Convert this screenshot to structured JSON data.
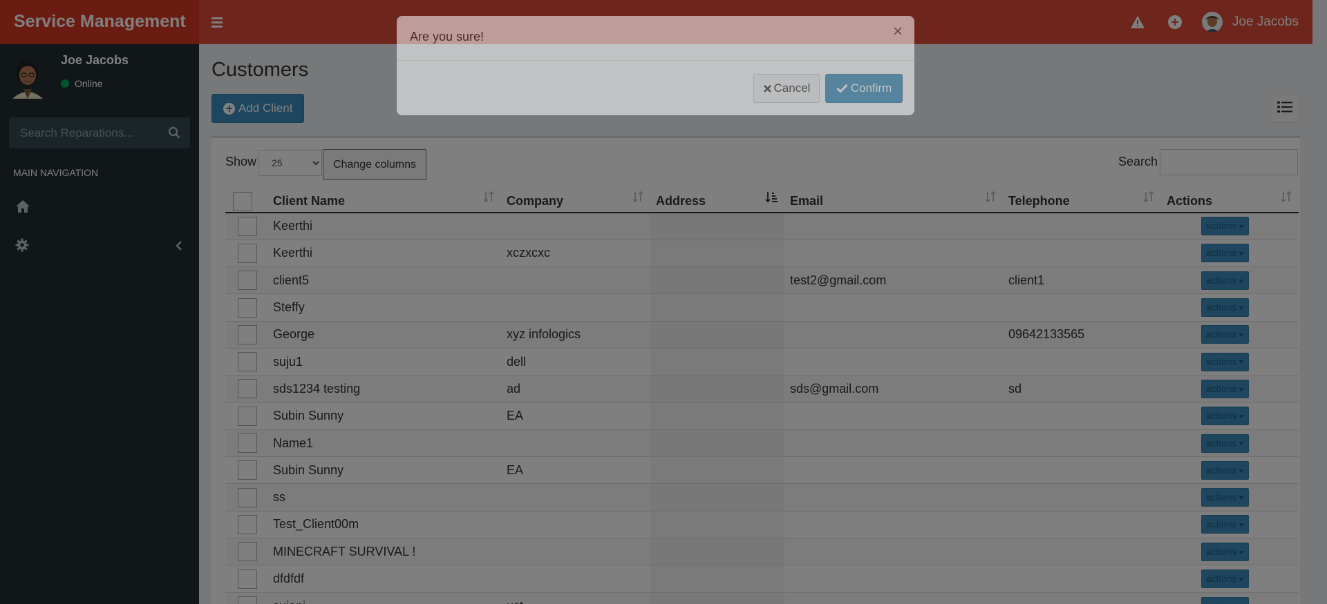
{
  "app": {
    "title": "Service Management"
  },
  "header": {
    "user_name": "Joe Jacobs"
  },
  "sidebar": {
    "user": {
      "name": "Joe Jacobs",
      "status": "Online"
    },
    "search": {
      "placeholder": "Search Reparations..."
    },
    "nav_header": "MAIN NAVIGATION"
  },
  "main": {
    "page_title": "Customers",
    "add_client_label": "Add Client",
    "show_label": "Show",
    "page_length": "25",
    "change_columns_label": "Change columns",
    "search_label": "Search",
    "columns": [
      "Client Name",
      "Company",
      "Address",
      "Email",
      "Telephone",
      "Actions"
    ],
    "rows": [
      {
        "name": "Keerthi",
        "company": "",
        "address": "",
        "email": "",
        "telephone": ""
      },
      {
        "name": "Keerthi",
        "company": "xczxcxc",
        "address": "",
        "email": "",
        "telephone": ""
      },
      {
        "name": "client5",
        "company": "",
        "address": "",
        "email": "test2@gmail.com",
        "telephone": "client1"
      },
      {
        "name": "Steffy",
        "company": "",
        "address": "",
        "email": "",
        "telephone": ""
      },
      {
        "name": "George",
        "company": "xyz infologics",
        "address": "",
        "email": "",
        "telephone": "09642133565"
      },
      {
        "name": "suju1",
        "company": "dell",
        "address": "",
        "email": "",
        "telephone": ""
      },
      {
        "name": "sds1234 testing",
        "company": "ad",
        "address": "",
        "email": "sds@gmail.com",
        "telephone": "sd"
      },
      {
        "name": "Subin Sunny",
        "company": "EA",
        "address": "",
        "email": "",
        "telephone": ""
      },
      {
        "name": "Name1",
        "company": "",
        "address": "",
        "email": "",
        "telephone": ""
      },
      {
        "name": "Subin Sunny",
        "company": "EA",
        "address": "",
        "email": "",
        "telephone": ""
      },
      {
        "name": "ss",
        "company": "",
        "address": "",
        "email": "",
        "telephone": ""
      },
      {
        "name": "Test_Client00m",
        "company": "",
        "address": "",
        "email": "",
        "telephone": ""
      },
      {
        "name": "MINECRAFT SURVIVAL !",
        "company": "",
        "address": "",
        "email": "",
        "telephone": ""
      },
      {
        "name": "dfdfdf",
        "company": "",
        "address": "",
        "email": "",
        "telephone": ""
      },
      {
        "name": "sujani",
        "company": "ust",
        "address": "",
        "email": "",
        "telephone": ""
      }
    ],
    "actions_label": "actions"
  },
  "modal": {
    "message": "Are you sure!",
    "close_symbol": "×",
    "cancel_label": "Cancel",
    "confirm_label": "Confirm"
  },
  "colors": {
    "header": "#dd4b39",
    "logo": "#d73925",
    "sidebar": "#222d32",
    "primary": "#3c8dbc"
  }
}
